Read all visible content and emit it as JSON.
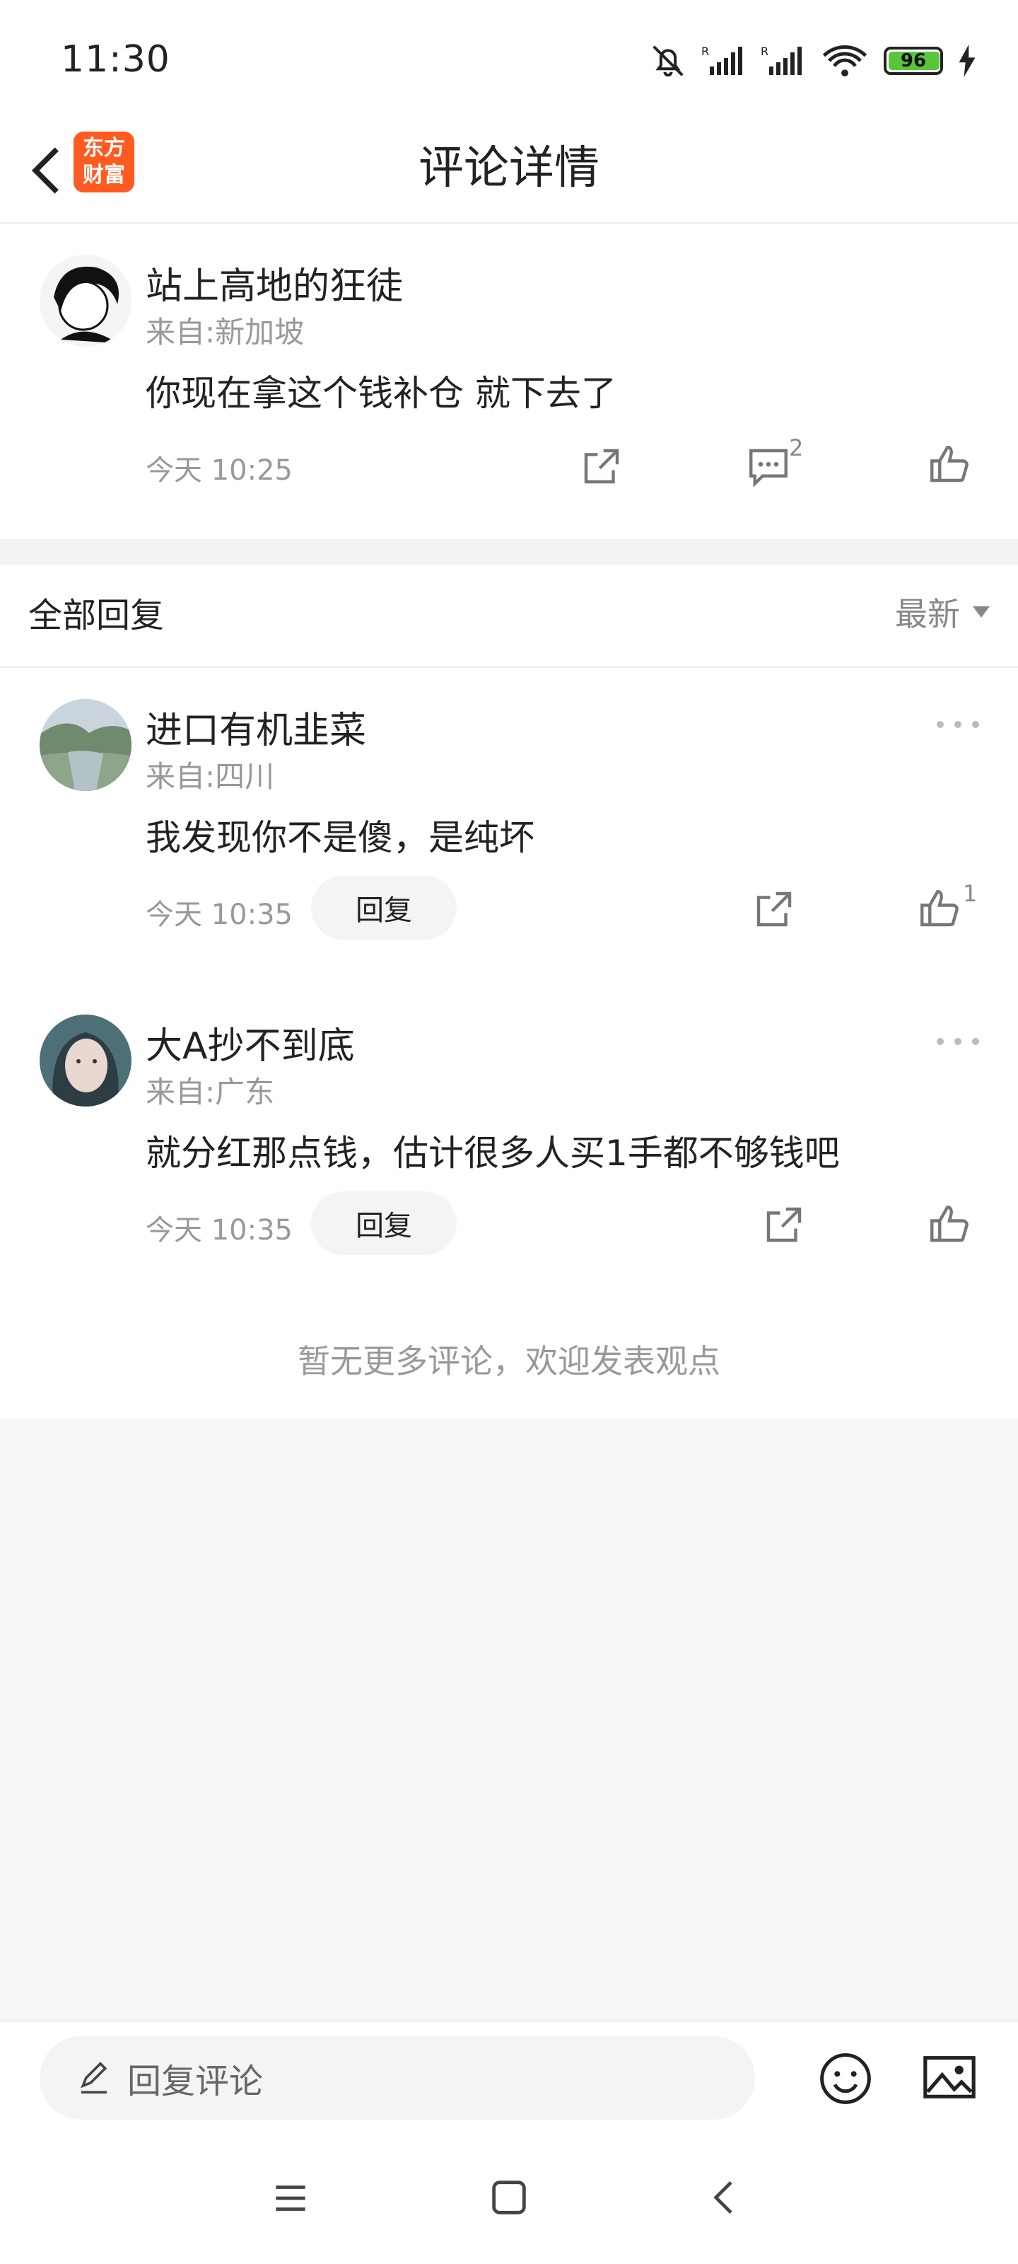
{
  "status_bar": {
    "time": "11:30",
    "battery": "96"
  },
  "header": {
    "title": "评论详情",
    "logo_line1": "东方",
    "logo_line2": "财富"
  },
  "main_comment": {
    "name": "站上高地的狂徒",
    "source": "来自:新加坡",
    "content": "你现在拿这个钱补仓 就下去了",
    "time": "今天 10:25",
    "comment_count": "2"
  },
  "replies_section": {
    "title": "全部回复",
    "sort": "最新"
  },
  "replies": [
    {
      "name": "进口有机韭菜",
      "source": "来自:四川",
      "content": "我发现你不是傻，是纯坏",
      "time": "今天 10:35",
      "reply_label": "回复",
      "like_count": "1"
    },
    {
      "name": "大A抄不到底",
      "source": "来自:广东",
      "content": "就分红那点钱，估计很多人买1手都不够钱吧",
      "time": "今天 10:35",
      "reply_label": "回复",
      "like_count": ""
    }
  ],
  "end_text": "暂无更多评论，欢迎发表观点",
  "bottom_bar": {
    "placeholder": "回复评论"
  },
  "colors": {
    "brand": "#ff5a1f",
    "background": "#f5f6f8",
    "muted": "#999999"
  },
  "icons": [
    "bell-off-icon",
    "signal-icon",
    "wifi-icon",
    "battery-icon",
    "charging-icon",
    "back-icon",
    "share-icon",
    "comment-icon",
    "like-icon",
    "more-icon",
    "edit-icon",
    "emoji-icon",
    "image-icon",
    "menu-icon",
    "home-icon",
    "nav-back-icon",
    "dropdown-icon"
  ]
}
